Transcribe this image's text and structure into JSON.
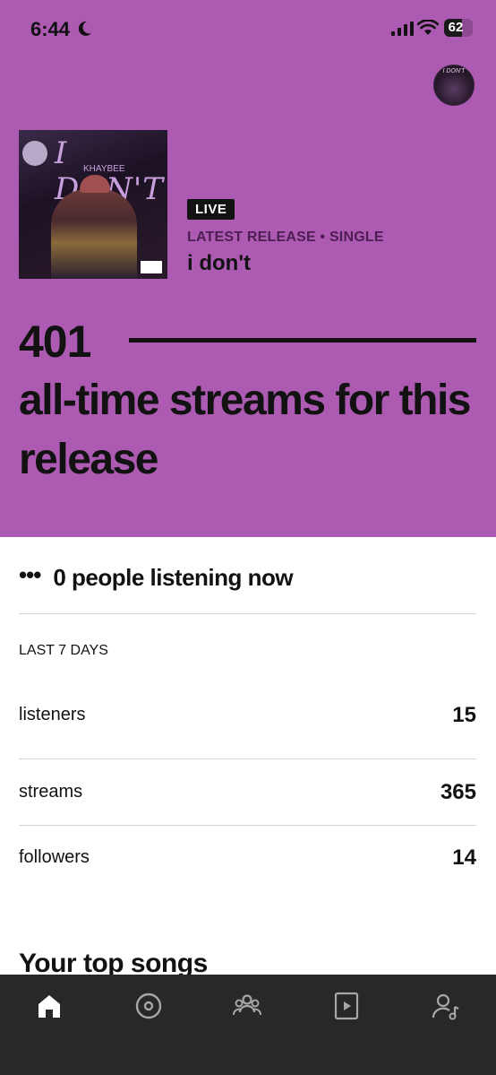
{
  "status_bar": {
    "time": "6:44",
    "battery_level": "62",
    "battery_fraction": 0.62
  },
  "release": {
    "badge": "LIVE",
    "type_label": "LATEST RELEASE • SINGLE",
    "title": "i don't",
    "cover_title": "I DON'T",
    "cover_artist": "KHAYBEE"
  },
  "streams": {
    "count": "401",
    "caption": "all-time streams for this release"
  },
  "live": {
    "text": "0 people listening now",
    "dots": "•••"
  },
  "stats": {
    "period_label": "LAST 7 DAYS",
    "rows": [
      {
        "label": "listeners",
        "value": "15"
      },
      {
        "label": "streams",
        "value": "365"
      },
      {
        "label": "followers",
        "value": "14"
      }
    ]
  },
  "section": {
    "top_songs_title": "Your top songs"
  },
  "tabbar": {
    "tabs": [
      {
        "icon": "home-icon",
        "active": true
      },
      {
        "icon": "music-icon",
        "active": false
      },
      {
        "icon": "audience-icon",
        "active": false
      },
      {
        "icon": "campaigns-icon",
        "active": false
      },
      {
        "icon": "profile-icon",
        "active": false
      }
    ]
  },
  "colors": {
    "hero_bg": "#ad5bb2",
    "tabbar_bg": "#282828",
    "accent_text": "#4e1d52"
  }
}
